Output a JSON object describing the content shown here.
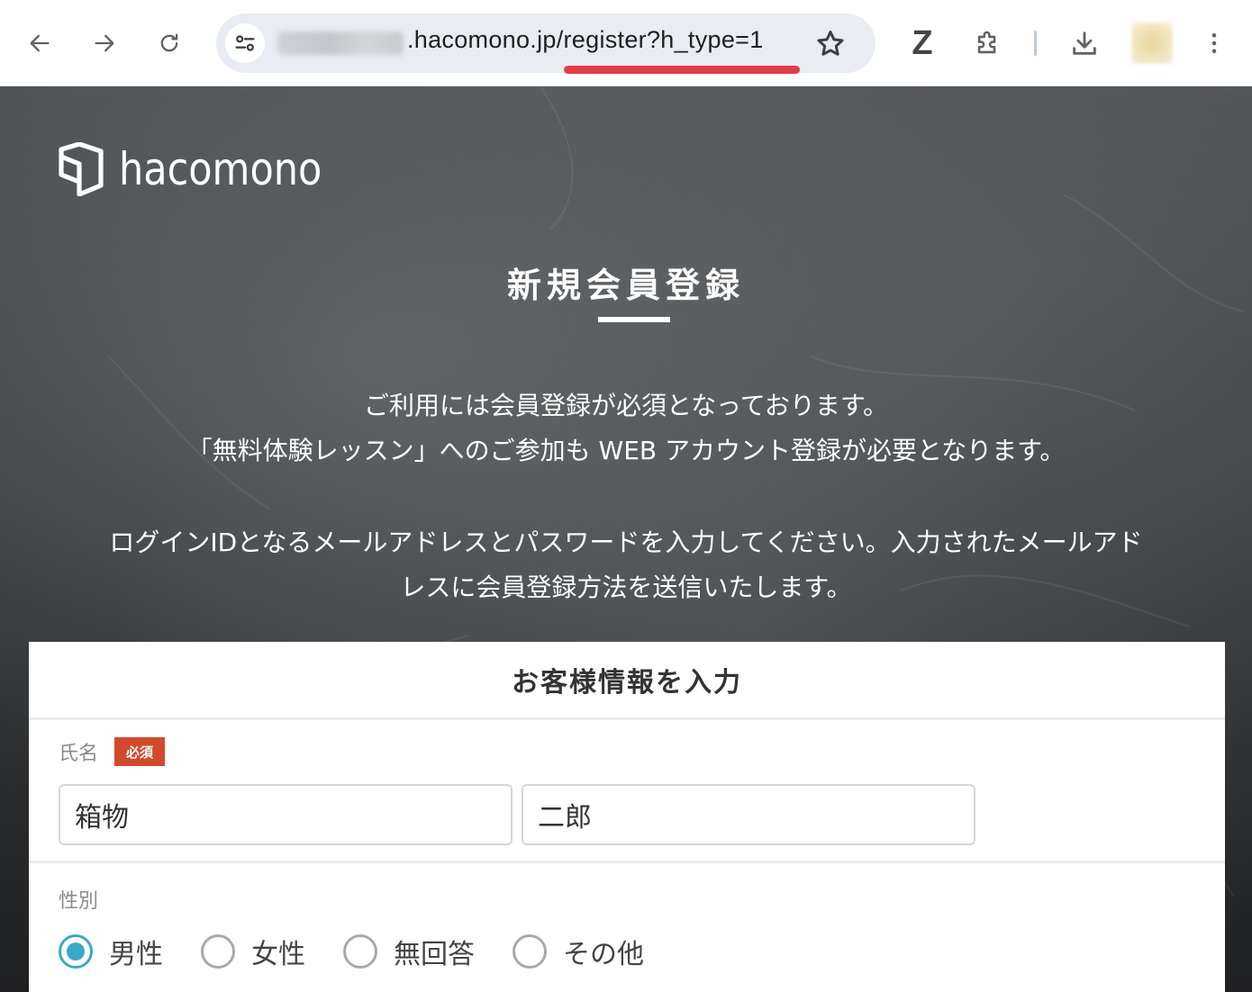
{
  "browser": {
    "url_host_suffix": ".hacomono.jp",
    "url_path": "/register?h_type=1",
    "extension_letter": "Z"
  },
  "header": {
    "logo_text": "hacomono"
  },
  "page": {
    "title": "新規会員登録",
    "intro_line1": "ご利用には会員登録が必須となっております。",
    "intro_line2": "「無料体験レッスン」へのご参加も WEB アカウント登録が必要となります。",
    "intro_line3": "ログインIDとなるメールアドレスとパスワードを入力してください。入力されたメールアド",
    "intro_line4": "レスに会員登録方法を送信いたします。"
  },
  "form": {
    "section_title": "お客様情報を入力",
    "name_field": {
      "label": "氏名",
      "required_badge": "必須",
      "last_name_value": "箱物",
      "first_name_value": "二郎"
    },
    "gender_field": {
      "label": "性別",
      "options": [
        {
          "label": "男性",
          "checked": true
        },
        {
          "label": "女性",
          "checked": false
        },
        {
          "label": "無回答",
          "checked": false
        },
        {
          "label": "その他",
          "checked": false
        }
      ]
    }
  },
  "colors": {
    "accent": "#3ba8c8",
    "required_badge": "#d24a2c",
    "url_highlight": "#e03d4a"
  }
}
